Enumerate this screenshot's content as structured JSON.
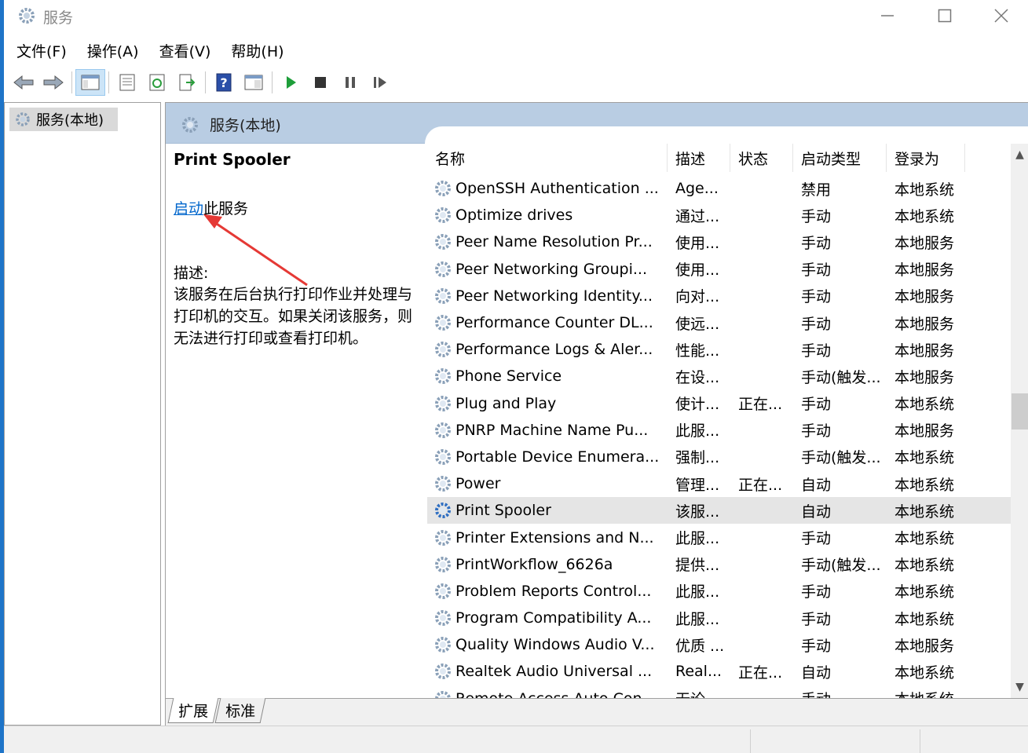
{
  "window": {
    "title": "服务"
  },
  "menu": [
    "文件(F)",
    "操作(A)",
    "查看(V)",
    "帮助(H)"
  ],
  "toolbar_icons": [
    "back-arrow-icon",
    "forward-arrow-icon",
    "console-tree-icon",
    "properties-icon",
    "refresh-icon",
    "export-icon",
    "help-icon",
    "view-icon",
    "start-service-icon",
    "stop-service-icon",
    "pause-service-icon",
    "resume-service-icon"
  ],
  "tree": {
    "root_label": "服务(本地)"
  },
  "content_header": {
    "title": "服务(本地)"
  },
  "selected_service": {
    "name": "Print Spooler",
    "action_link": "启动",
    "action_suffix": "此服务",
    "desc_label": "描述:",
    "description": "该服务在后台执行打印作业并处理与打印机的交互。如果关闭该服务，则无法进行打印或查看打印机。"
  },
  "columns": [
    "名称",
    "描述",
    "状态",
    "启动类型",
    "登录为"
  ],
  "services": [
    {
      "name": "OpenSSH Authentication ...",
      "desc": "Age...",
      "state": "",
      "startup": "禁用",
      "logon": "本地系统"
    },
    {
      "name": "Optimize drives",
      "desc": "通过...",
      "state": "",
      "startup": "手动",
      "logon": "本地系统"
    },
    {
      "name": "Peer Name Resolution Pr...",
      "desc": "使用...",
      "state": "",
      "startup": "手动",
      "logon": "本地服务"
    },
    {
      "name": "Peer Networking Groupi...",
      "desc": "使用...",
      "state": "",
      "startup": "手动",
      "logon": "本地服务"
    },
    {
      "name": "Peer Networking Identity...",
      "desc": "向对...",
      "state": "",
      "startup": "手动",
      "logon": "本地服务"
    },
    {
      "name": "Performance Counter DL...",
      "desc": "使远...",
      "state": "",
      "startup": "手动",
      "logon": "本地服务"
    },
    {
      "name": "Performance Logs & Aler...",
      "desc": "性能...",
      "state": "",
      "startup": "手动",
      "logon": "本地服务"
    },
    {
      "name": "Phone Service",
      "desc": "在设...",
      "state": "",
      "startup": "手动(触发...",
      "logon": "本地服务"
    },
    {
      "name": "Plug and Play",
      "desc": "使计...",
      "state": "正在...",
      "startup": "手动",
      "logon": "本地系统"
    },
    {
      "name": "PNRP Machine Name Pu...",
      "desc": "此服...",
      "state": "",
      "startup": "手动",
      "logon": "本地服务"
    },
    {
      "name": "Portable Device Enumera...",
      "desc": "强制...",
      "state": "",
      "startup": "手动(触发...",
      "logon": "本地系统"
    },
    {
      "name": "Power",
      "desc": "管理...",
      "state": "正在...",
      "startup": "自动",
      "logon": "本地系统"
    },
    {
      "name": "Print Spooler",
      "desc": "该服...",
      "state": "",
      "startup": "自动",
      "logon": "本地系统",
      "selected": true
    },
    {
      "name": "Printer Extensions and N...",
      "desc": "此服...",
      "state": "",
      "startup": "手动",
      "logon": "本地系统"
    },
    {
      "name": "PrintWorkflow_6626a",
      "desc": "提供...",
      "state": "",
      "startup": "手动(触发...",
      "logon": "本地系统"
    },
    {
      "name": "Problem Reports Control...",
      "desc": "此服...",
      "state": "",
      "startup": "手动",
      "logon": "本地系统"
    },
    {
      "name": "Program Compatibility A...",
      "desc": "此服...",
      "state": "",
      "startup": "手动",
      "logon": "本地系统"
    },
    {
      "name": "Quality Windows Audio V...",
      "desc": "优质 ...",
      "state": "",
      "startup": "手动",
      "logon": "本地服务"
    },
    {
      "name": "Realtek Audio Universal ...",
      "desc": "Real...",
      "state": "正在...",
      "startup": "自动",
      "logon": "本地系统"
    },
    {
      "name": "Remote Access Auto Con...",
      "desc": "无论...",
      "state": "",
      "startup": "手动",
      "logon": "本地系统"
    }
  ],
  "tabs": [
    "扩展",
    "标准"
  ],
  "colors": {
    "header_bg": "#b9cde3",
    "link": "#0066cc",
    "selected_row": "#e5e5e5",
    "annotation_arrow": "#e53935"
  }
}
